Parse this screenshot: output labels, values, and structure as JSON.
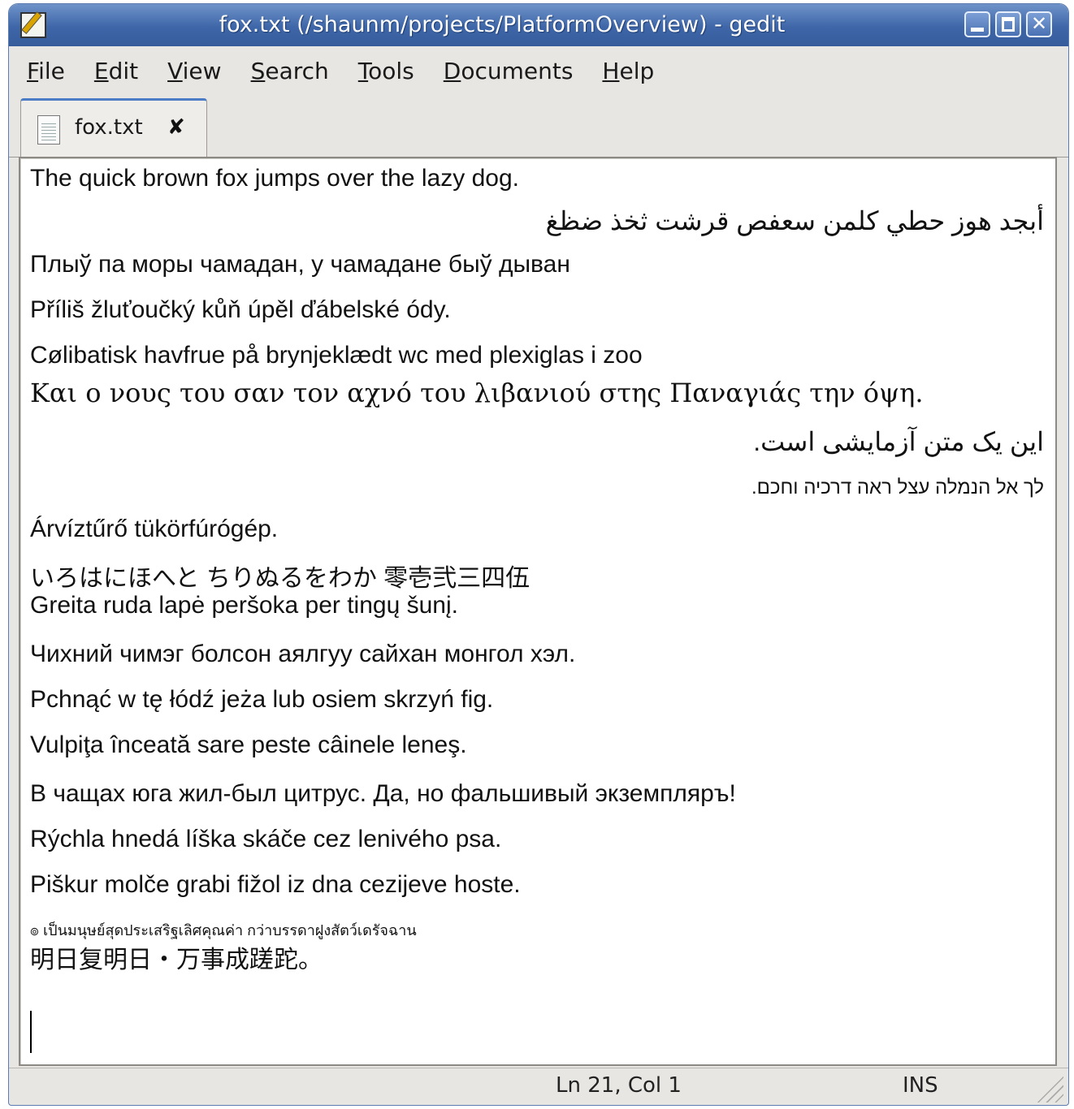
{
  "window": {
    "title": "fox.txt (/shaunm/projects/PlatformOverview) - gedit",
    "app_icon": "gedit-notepad-icon",
    "controls": {
      "minimize": "_",
      "maximize": "□",
      "close": "✕"
    }
  },
  "menu": {
    "file": {
      "mnemonic": "F",
      "rest": "ile"
    },
    "edit": {
      "mnemonic": "E",
      "rest": "dit"
    },
    "view": {
      "mnemonic": "V",
      "rest": "iew"
    },
    "search": {
      "mnemonic": "S",
      "rest": "earch"
    },
    "tools": {
      "mnemonic": "T",
      "rest": "ools"
    },
    "documents": {
      "mnemonic": "D",
      "rest": "ocuments"
    },
    "help": {
      "mnemonic": "H",
      "rest": "elp"
    }
  },
  "tab": {
    "label": "fox.txt",
    "close": "✘",
    "icon": "text-document-icon"
  },
  "document": {
    "lines": [
      "The quick brown fox jumps over the lazy dog.",
      "أبجد هوز حطي كلمن سعفص قرشت ثخذ ضظغ",
      "Плыў па моры чамадан, у чамадане быў дыван",
      "Příliš žluťoučký kůň úpěl ďábelské ódy.",
      "Cølibatisk havfrue på brynjeklædt wc med plexiglas i zoo",
      "Και ο νους του σαν τον αχνό του λιβανιού στης Παναγιάς την όψη.",
      "این یک متن آزمایشی است.",
      "לך אל הנמלה עצל ראה דרכיה וחכם.",
      "Árvíztűrő tükörfúrógép.",
      "いろはにほへと ちりぬるをわか 零壱弐三四伍",
      "Greita ruda lapė peršoka per tingų šunį.",
      "Чихний чимэг болсон аялгуу сайхан монгол хэл.",
      "Pchnąć w tę łódź jeża lub osiem skrzyń fig.",
      "Vulpiţa înceată sare peste câinele leneş.",
      "В чащах юга жил-был цитрус. Да, но фальшивый экземпляръ!",
      "Rýchla hnedá líška skáče cez lenivého psa.",
      "Piškur molče grabi fižol iz dna cezijeve hoste.",
      "๏ เป็นมนุษย์สุดประเสริฐเลิศคุณค่า กว่าบรรดาฝูงสัตว์เดรัจฉาน",
      "明日复明日・万事成蹉跎。"
    ]
  },
  "status": {
    "position": "Ln 21, Col 1",
    "mode": "INS"
  }
}
